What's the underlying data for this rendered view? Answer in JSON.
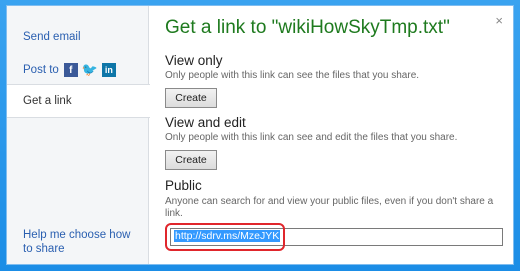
{
  "sidebar": {
    "send_email": "Send email",
    "post_to": "Post to",
    "get_link": "Get a link",
    "help": "Help me choose how to share"
  },
  "dialog": {
    "title": "Get a link to \"wikiHowSkyTmp.txt\"",
    "close": "×"
  },
  "sections": {
    "view_only": {
      "heading": "View only",
      "description": "Only people with this link can see the files that you share.",
      "button": "Create"
    },
    "view_edit": {
      "heading": "View and edit",
      "description": "Only people with this link can see and edit the files that you share.",
      "button": "Create"
    },
    "public": {
      "heading": "Public",
      "description": "Anyone can search for and view your public files, even if you don't share a link.",
      "link_value": "http://sdrv.ms/MzeJYK"
    }
  },
  "icons": [
    "facebook-icon",
    "twitter-icon",
    "linkedin-icon"
  ],
  "colors": {
    "title_green": "#1e7a1e",
    "link_blue": "#2a5fb0",
    "highlight_red": "#e0262c",
    "frame_blue": "#1a8fe6"
  }
}
